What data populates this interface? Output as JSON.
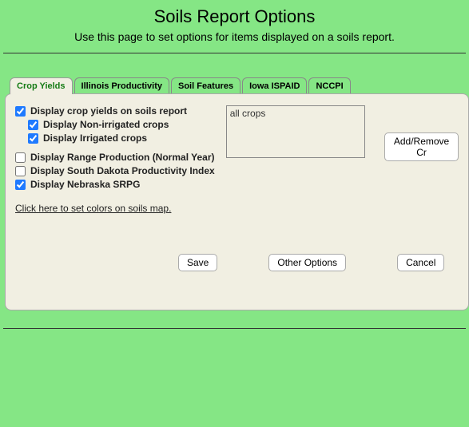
{
  "header": {
    "title": "Soils Report Options",
    "subtitle": "Use this page to set options for items displayed on a soils report."
  },
  "tabs": {
    "crop_yields": "Crop Yields",
    "illinois": "Illinois Productivity",
    "soil_features": "Soil Features",
    "iowa": "Iowa ISPAID",
    "nccpi": "NCCPI"
  },
  "options": {
    "display_crop_yields": {
      "label": "Display crop yields on soils report",
      "checked": true
    },
    "non_irrigated": {
      "label": "Display Non-irrigated crops",
      "checked": true
    },
    "irrigated": {
      "label": "Display Irrigated crops",
      "checked": true
    },
    "range_production": {
      "label": "Display Range Production (Normal Year)",
      "checked": false
    },
    "south_dakota": {
      "label": "Display South Dakota Productivity Index",
      "checked": false
    },
    "nebraska": {
      "label": "Display Nebraska SRPG",
      "checked": true
    }
  },
  "listbox": {
    "selected": "all crops"
  },
  "buttons": {
    "add_remove": "Add/Remove Cr",
    "save": "Save",
    "other_options": "Other Options",
    "cancel": "Cancel"
  },
  "link": {
    "colors": "Click here to set colors on soils map. "
  }
}
